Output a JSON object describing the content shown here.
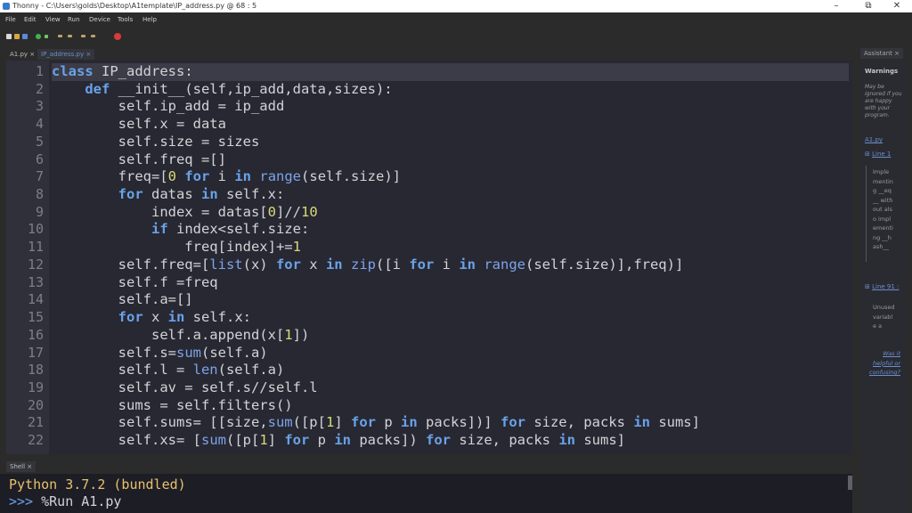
{
  "window": {
    "title": "Thonny  -  C:\\Users\\golds\\Desktop\\A1template\\IP_address.py  @  68 : 5",
    "minimize_glyph": "–",
    "maximize_glyph": "⧉",
    "close_glyph": "✕"
  },
  "menu": [
    "File",
    "Edit",
    "View",
    "Run",
    "Device",
    "Tools",
    "Help"
  ],
  "editor_tabs": [
    {
      "label": "A1.py ×",
      "active": false
    },
    {
      "label": "IP_address.py ×",
      "active": true
    }
  ],
  "editor": {
    "line_numbers": [
      "1",
      "2",
      "3",
      "4",
      "5",
      "6",
      "7",
      "8",
      "9",
      "10",
      "11",
      "12",
      "13",
      "14",
      "15",
      "16",
      "17",
      "18",
      "19",
      "20",
      "21",
      "22"
    ],
    "lines": [
      "class IP_address:",
      "    def __init__(self,ip_add,data,sizes):",
      "        self.ip_add = ip_add",
      "        self.x = data",
      "        self.size = sizes",
      "        self.freq =[]",
      "        freq=[0 for i in range(self.size)]",
      "        for datas in self.x:",
      "            index = datas[0]//10",
      "            if index<self.size:",
      "                freq[index]+=1",
      "        self.freq=[list(x) for x in zip([i for i in range(self.size)],freq)]",
      "        self.f =freq",
      "        self.a=[]",
      "        for x in self.x:",
      "            self.a.append(x[1])",
      "        self.s=sum(self.a)",
      "        self.l = len(self.a)",
      "        self.av = self.s//self.l",
      "        sums = self.filters()",
      "        self.sums= [[size,sum([p[1] for p in packs])] for size, packs in sums]",
      "        self.xs= [sum([p[1] for p in packs]) for size, packs in sums]"
    ]
  },
  "shell": {
    "tab_label": "Shell ×",
    "banner": "Python 3.7.2 (bundled)",
    "prompt": ">>>",
    "command": " %Run A1.py"
  },
  "assistant": {
    "tab_label": "Assistant ×",
    "heading": "Warnings",
    "note": "May be ignored if you are happy with your program.",
    "file_link": "A1.py",
    "line1_link": "Line 1",
    "line1_msg": "Implementing __eq__ without also implementing __hash__",
    "line91_link": "Line 91 :",
    "line91_msg": "Unused variable a",
    "feedback": "Was it helpful or confusing?"
  },
  "colors": {
    "editor_bg": "#272832",
    "keyword": "#6aa2e8",
    "number": "#d9d977",
    "shell_banner": "#e8c26a",
    "shell_prompt": "#6aa2e8",
    "link": "#6b8fd0"
  }
}
